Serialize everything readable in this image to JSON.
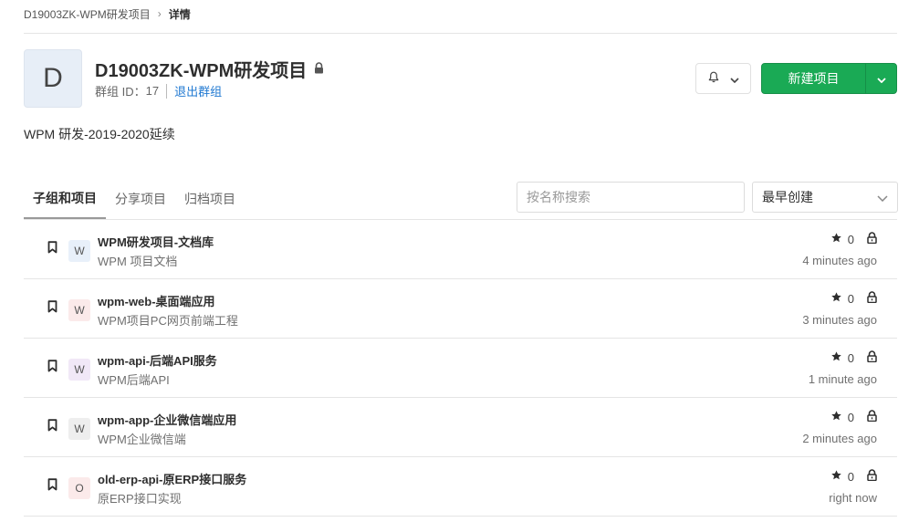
{
  "breadcrumb": {
    "group": "D19003ZK-WPM研发项目",
    "current": "详情"
  },
  "group": {
    "avatar_letter": "D",
    "name": "D19003ZK-WPM研发项目",
    "id_label": "群组 ID：",
    "id_value": "17",
    "leave_link": "退出群组",
    "description": "WPM 研发-2019-2020延续"
  },
  "actions": {
    "new_project_label": "新建项目"
  },
  "tabs": [
    {
      "label": "子组和项目",
      "active": true
    },
    {
      "label": "分享项目",
      "active": false
    },
    {
      "label": "归档项目",
      "active": false
    }
  ],
  "search": {
    "placeholder": "按名称搜索",
    "value": ""
  },
  "sort": {
    "selected": "最早创建"
  },
  "projects": [
    {
      "letter": "W",
      "avatar_bg": "#e8f0fa",
      "name": "WPM研发项目-文档库",
      "description": "WPM 项目文档",
      "stars": "0",
      "updated": "4 minutes ago"
    },
    {
      "letter": "W",
      "avatar_bg": "#fbeaea",
      "name": "wpm-web-桌面端应用",
      "description": "WPM项目PC网页前端工程",
      "stars": "0",
      "updated": "3 minutes ago"
    },
    {
      "letter": "W",
      "avatar_bg": "#f1e8f7",
      "name": "wpm-api-后端API服务",
      "description": "WPM后端API",
      "stars": "0",
      "updated": "1 minute ago"
    },
    {
      "letter": "W",
      "avatar_bg": "#eeeeee",
      "name": "wpm-app-企业微信端应用",
      "description": "WPM企业微信端",
      "stars": "0",
      "updated": "2 minutes ago"
    },
    {
      "letter": "O",
      "avatar_bg": "#fbeaea",
      "name": "old-erp-api-原ERP接口服务",
      "description": "原ERP接口实现",
      "stars": "0",
      "updated": "right now"
    }
  ],
  "icons": {
    "lock": "lock-icon",
    "bell": "bell-icon",
    "chevron": "chevron-down-icon",
    "star": "star-icon",
    "bookmark": "bookmark-icon"
  },
  "colors": {
    "primary_button": "#1aaa55",
    "link": "#1f78d1"
  }
}
